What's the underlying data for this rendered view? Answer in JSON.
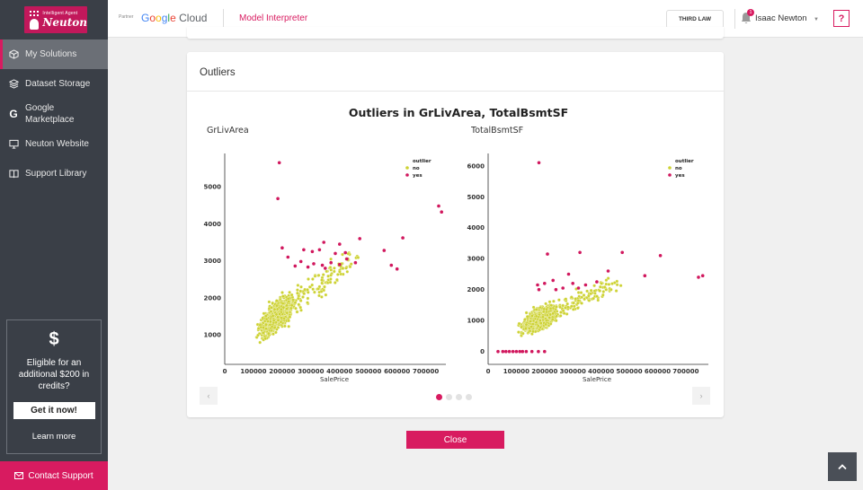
{
  "logo": {
    "small": "Intelligent Agent",
    "big": "Neuton"
  },
  "sidebar": {
    "items": [
      {
        "label": "My Solutions",
        "icon": "cube-icon",
        "active": true
      },
      {
        "label": "Dataset Storage",
        "icon": "layers-icon"
      },
      {
        "label": "Google\nMarketplace",
        "icon": "google-g-icon"
      },
      {
        "label": "Neuton Website",
        "icon": "monitor-icon"
      },
      {
        "label": "Support Library",
        "icon": "book-icon"
      }
    ],
    "promo": {
      "symbol": "$",
      "text": "Eligible for an additional $200 in credits?",
      "button": "Get it now!",
      "link": "Learn more"
    },
    "contact": "Contact Support"
  },
  "topbar": {
    "partner": "Partner",
    "google": [
      "G",
      "o",
      "o",
      "g",
      "l",
      "e"
    ],
    "cloud": "Cloud",
    "section": "Model Interpreter",
    "third_law": "THIRD LAW",
    "notifications": "1",
    "user": "Isaac Newton",
    "help": "?"
  },
  "card": {
    "title": "Outliers"
  },
  "close_button": "Close",
  "colors": {
    "accent": "#d81b60",
    "no": "#cdd233",
    "yes": "#d1185e",
    "sidebar": "#3a3f47"
  },
  "chart_data": {
    "type": "scatter",
    "title": "Outliers in GrLivArea, TotalBsmtSF",
    "legend_title": "outlier",
    "legend": [
      "no",
      "yes"
    ],
    "legend_placement": "top-right",
    "carousel": {
      "pages": 4,
      "current": 1
    },
    "panels": [
      {
        "subtitle": "GrLivArea",
        "xlabel": "SalePrice",
        "xlim": [
          0,
          770000
        ],
        "ylim": [
          300,
          5900
        ],
        "xticks": [
          0,
          100000,
          200000,
          300000,
          400000,
          500000,
          600000,
          700000
        ],
        "xtick_labels": [
          "0",
          "100000",
          "200000",
          "300000",
          "400000",
          "500000",
          "600000",
          "700000"
        ],
        "yticks": [
          1000,
          2000,
          3000,
          4000,
          5000
        ],
        "ytick_labels": [
          "1000",
          "2000",
          "3000",
          "4000",
          "5000"
        ],
        "cloud": {
          "x_center": 180000,
          "y_base": 1500,
          "slope": 0.0057,
          "count": 900
        },
        "yes": [
          [
            190000,
            5650
          ],
          [
            185000,
            4680
          ],
          [
            745000,
            4480
          ],
          [
            755000,
            4320
          ],
          [
            620000,
            3620
          ],
          [
            470000,
            3600
          ],
          [
            345000,
            3500
          ],
          [
            400000,
            3450
          ],
          [
            385000,
            3200
          ],
          [
            420000,
            3220
          ],
          [
            555000,
            3280
          ],
          [
            200000,
            3350
          ],
          [
            275000,
            3300
          ],
          [
            305000,
            3250
          ],
          [
            330000,
            3300
          ],
          [
            220000,
            3100
          ],
          [
            265000,
            2980
          ],
          [
            310000,
            2920
          ],
          [
            340000,
            2880
          ],
          [
            370000,
            2950
          ],
          [
            400000,
            2900
          ],
          [
            425000,
            3050
          ],
          [
            455000,
            2950
          ],
          [
            580000,
            2880
          ],
          [
            600000,
            2780
          ],
          [
            245000,
            2860
          ],
          [
            290000,
            2830
          ],
          [
            350000,
            2800
          ]
        ]
      },
      {
        "subtitle": "TotalBsmtSF",
        "xlabel": "SalePrice",
        "xlim": [
          0,
          780000
        ],
        "ylim": [
          -300,
          6400
        ],
        "xticks": [
          0,
          100000,
          200000,
          300000,
          400000,
          500000,
          600000,
          700000
        ],
        "xtick_labels": [
          "0",
          "100000",
          "200000",
          "300000",
          "400000",
          "500000",
          "600000",
          "700000"
        ],
        "yticks": [
          0,
          1000,
          2000,
          3000,
          4000,
          5000,
          6000
        ],
        "ytick_labels": [
          "0",
          "1000",
          "2000",
          "3000",
          "4000",
          "5000",
          "6000"
        ],
        "cloud": {
          "x_center": 180000,
          "y_base": 1050,
          "slope": 0.0045,
          "count": 900
        },
        "yes": [
          [
            180000,
            6100
          ],
          [
            210000,
            3150
          ],
          [
            325000,
            3200
          ],
          [
            475000,
            3200
          ],
          [
            610000,
            3100
          ],
          [
            285000,
            2500
          ],
          [
            425000,
            2600
          ],
          [
            555000,
            2450
          ],
          [
            745000,
            2400
          ],
          [
            760000,
            2450
          ],
          [
            175000,
            2150
          ],
          [
            200000,
            2200
          ],
          [
            230000,
            2300
          ],
          [
            265000,
            2050
          ],
          [
            300000,
            2200
          ],
          [
            345000,
            2150
          ],
          [
            385000,
            2250
          ],
          [
            180000,
            2000
          ],
          [
            240000,
            2000
          ],
          [
            320000,
            2050
          ],
          [
            35000,
            0
          ],
          [
            52000,
            0
          ],
          [
            63000,
            0
          ],
          [
            75000,
            0
          ],
          [
            88000,
            0
          ],
          [
            100000,
            0
          ],
          [
            112000,
            0
          ],
          [
            122000,
            0
          ],
          [
            135000,
            0
          ],
          [
            155000,
            0
          ],
          [
            178000,
            0
          ],
          [
            200000,
            0
          ]
        ]
      }
    ]
  }
}
